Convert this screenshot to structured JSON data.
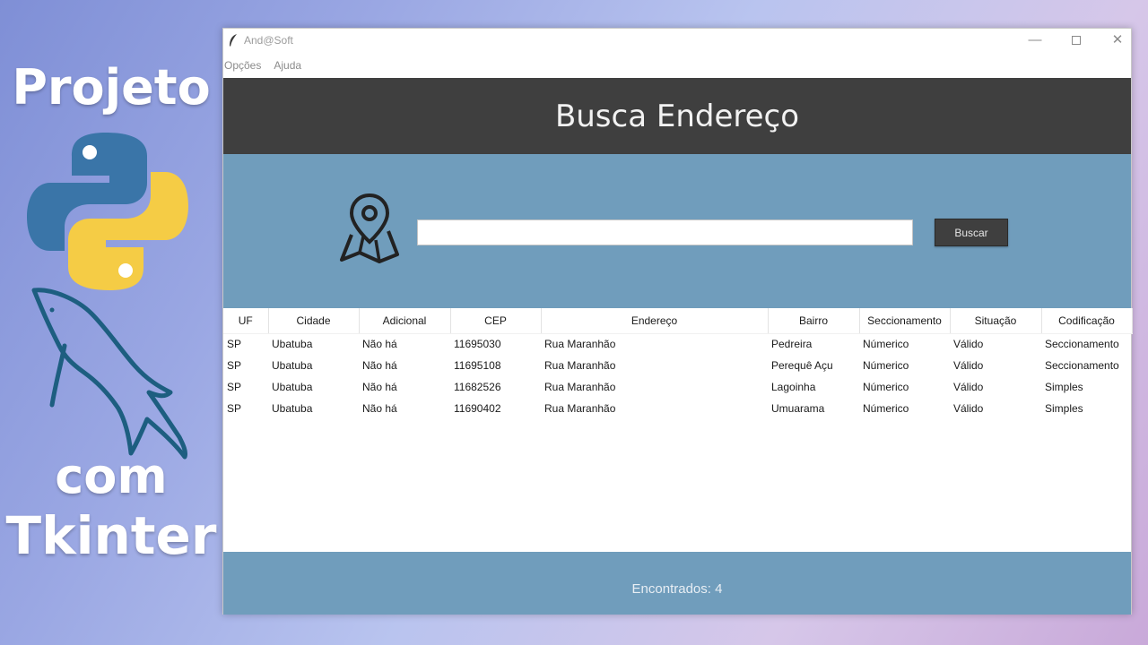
{
  "promo": {
    "top_text": "Projeto",
    "middle_text": "com",
    "bottom_text": "Tkinter"
  },
  "window": {
    "title": "And@Soft",
    "controls": {
      "minimize": "—",
      "close": "✕"
    }
  },
  "menu": {
    "items": [
      {
        "label": "Opções"
      },
      {
        "label": "Ajuda"
      }
    ]
  },
  "header": {
    "title": "Busca Endereço"
  },
  "search": {
    "value": "",
    "button_label": "Buscar"
  },
  "table": {
    "columns": [
      "UF",
      "Cidade",
      "Adicional",
      "CEP",
      "Endereço",
      "Bairro",
      "Seccionamento",
      "Situação",
      "Codificação"
    ],
    "rows": [
      [
        "SP",
        "Ubatuba",
        "Não há",
        "11695030",
        "Rua Maranhão",
        "Pedreira",
        "Númerico",
        "Válido",
        "Seccionamento"
      ],
      [
        "SP",
        "Ubatuba",
        "Não há",
        "11695108",
        "Rua Maranhão",
        "Perequê Açu",
        "Númerico",
        "Válido",
        "Seccionamento"
      ],
      [
        "SP",
        "Ubatuba",
        "Não há",
        "11682526",
        "Rua Maranhão",
        "Lagoinha",
        "Númerico",
        "Válido",
        "Simples"
      ],
      [
        "SP",
        "Ubatuba",
        "Não há",
        "11690402",
        "Rua Maranhão",
        "Umuarama",
        "Númerico",
        "Válido",
        "Simples"
      ]
    ]
  },
  "footer": {
    "status": "Encontrados: 4"
  },
  "colors": {
    "header_bg": "#3f3f3f",
    "panel_bg": "#709dbc",
    "python_blue": "#3a75a8",
    "python_yellow": "#f5cc45",
    "dolphin": "#1d5e80"
  },
  "icons": {
    "app": "feather-icon",
    "search_panel": "map-pin-icon",
    "promo_logo": "python-logo-icon",
    "promo_mascot": "mysql-dolphin-icon"
  }
}
